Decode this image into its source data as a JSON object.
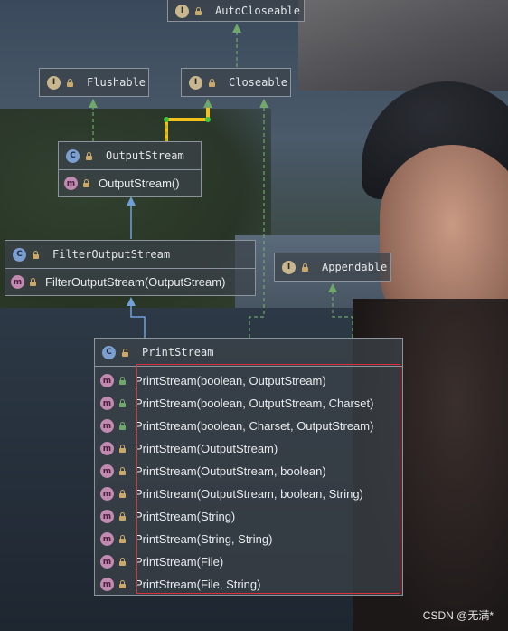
{
  "nodes": {
    "autocloseable": {
      "name": "AutoCloseable",
      "kind": "I"
    },
    "flushable": {
      "name": "Flushable",
      "kind": "I"
    },
    "closeable": {
      "name": "Closeable",
      "kind": "I"
    },
    "outputstream": {
      "name": "OutputStream",
      "kind": "C",
      "members": [
        "OutputStream()"
      ]
    },
    "filteroutputstream": {
      "name": "FilterOutputStream",
      "kind": "C",
      "members": [
        "FilterOutputStream(OutputStream)"
      ]
    },
    "appendable": {
      "name": "Appendable",
      "kind": "I"
    },
    "printstream": {
      "name": "PrintStream",
      "kind": "C",
      "members": [
        "PrintStream(boolean, OutputStream)",
        "PrintStream(boolean, OutputStream, Charset)",
        "PrintStream(boolean, Charset, OutputStream)",
        "PrintStream(OutputStream)",
        "PrintStream(OutputStream, boolean)",
        "PrintStream(OutputStream, boolean, String)",
        "PrintStream(String)",
        "PrintStream(String, String)",
        "PrintStream(File)",
        "PrintStream(File, String)"
      ]
    }
  },
  "method_badge": "m",
  "colors": {
    "interface_edge": "#6fa86a",
    "class_edge": "#6fa1d8",
    "highlight": "#d9323a"
  },
  "watermark": "CSDN @无满*"
}
